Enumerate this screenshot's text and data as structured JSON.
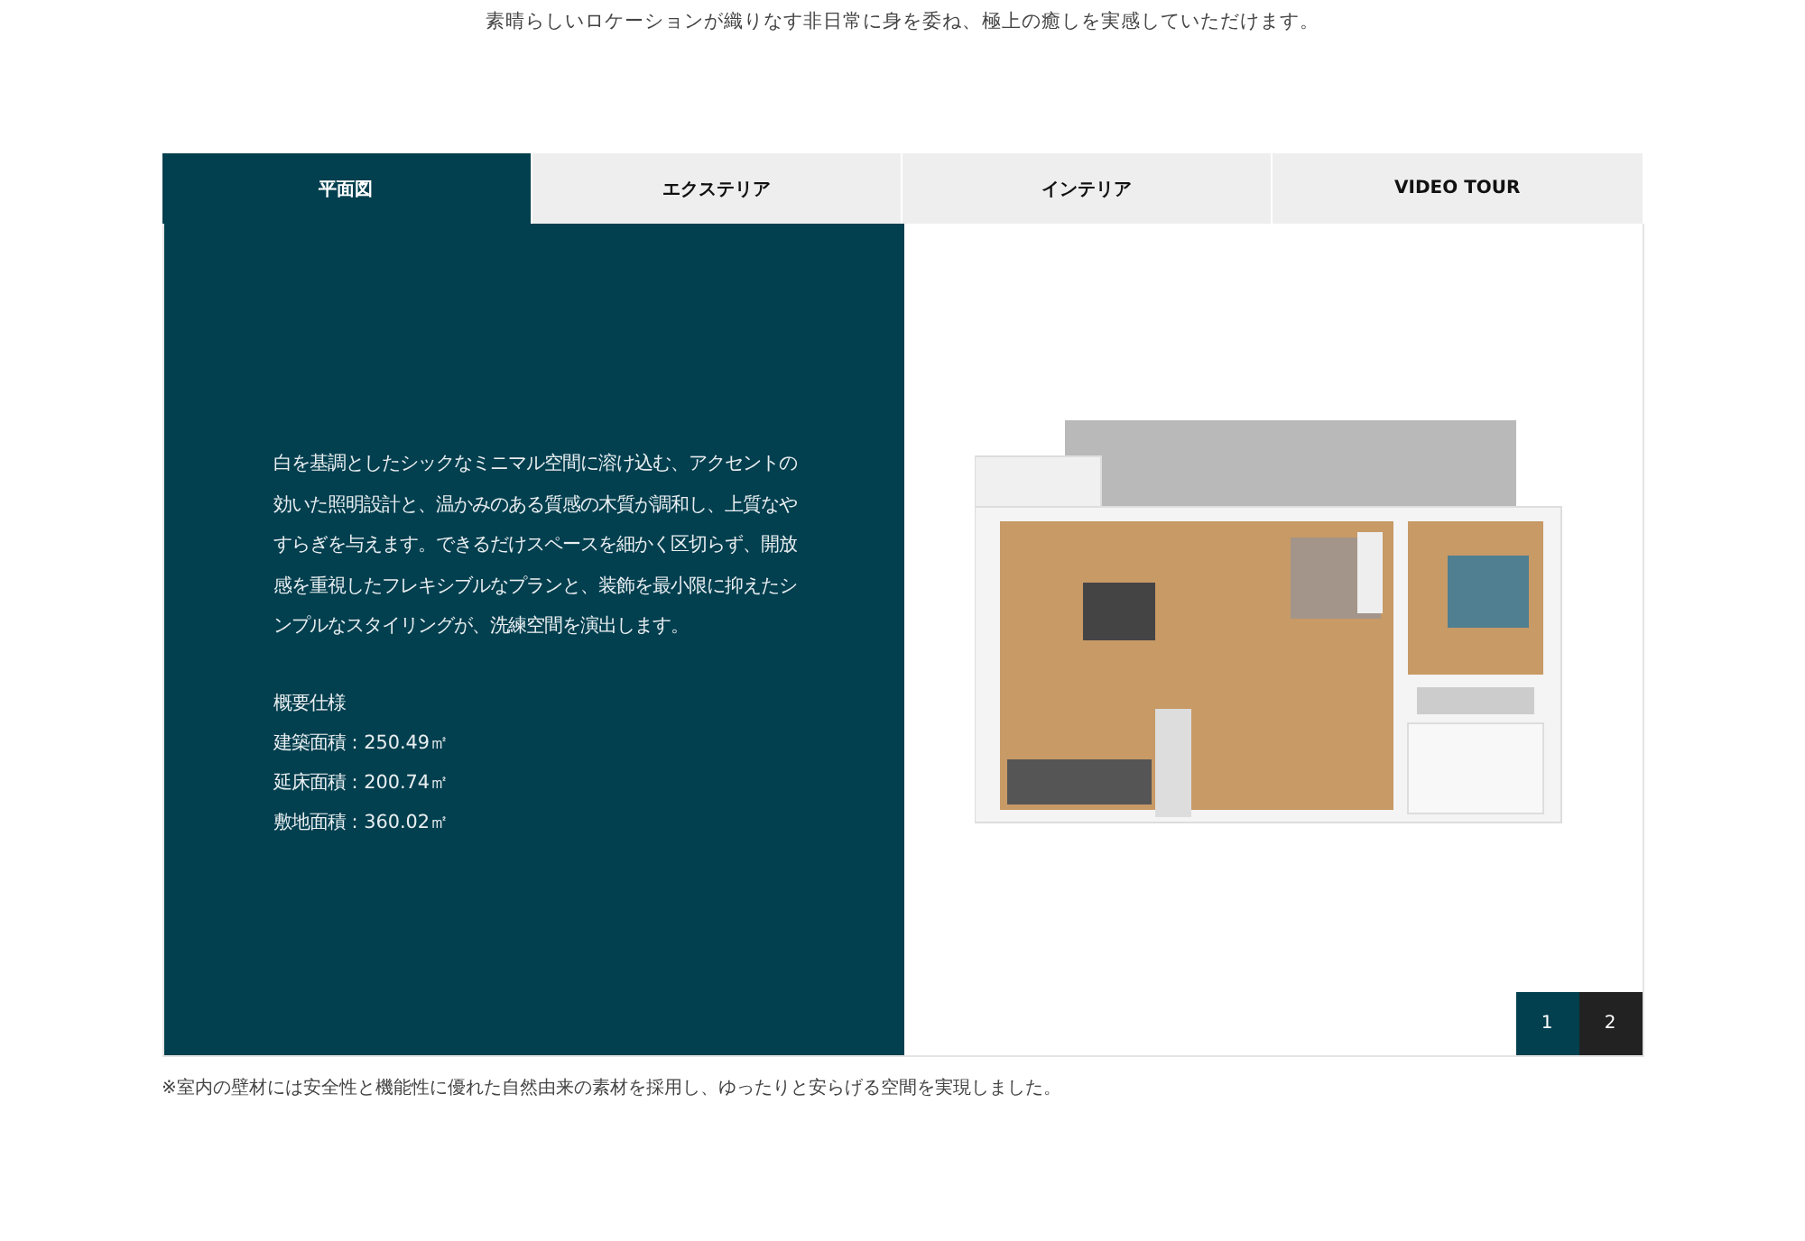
{
  "intro": "素晴らしいロケーションが織りなす非日常に身を委ね、極上の癒しを実感していただけます。",
  "tabs": [
    {
      "label": "平面図",
      "selected": true
    },
    {
      "label": "エクステリア",
      "selected": false
    },
    {
      "label": "インテリア",
      "selected": false
    },
    {
      "label": "VIDEO TOUR",
      "selected": false
    }
  ],
  "description": "白を基調としたシックなミニマル空間に溶け込む、アクセントの効いた照明設計と、温かみのある質感の木質が調和し、上質なやすらぎを与えます。できるだけスペースを細かく区切らず、開放感を重視したフレキシブルなプランと、装飾を最小限に抑えたシンプルなスタイリングが、洗練空間を演出します。",
  "spec_title": "概要仕様",
  "specs": [
    "建築面積 : 250.49㎡",
    "延床面積 : 200.74㎡",
    "敷地面積 : 360.02㎡"
  ],
  "pages": [
    {
      "label": "1",
      "selected": true
    },
    {
      "label": "2",
      "selected": false
    }
  ],
  "note": "※室内の壁材には安全性と機能性に優れた自然由来の素材を採用し、ゆったりと安らげる空間を実現しました。"
}
